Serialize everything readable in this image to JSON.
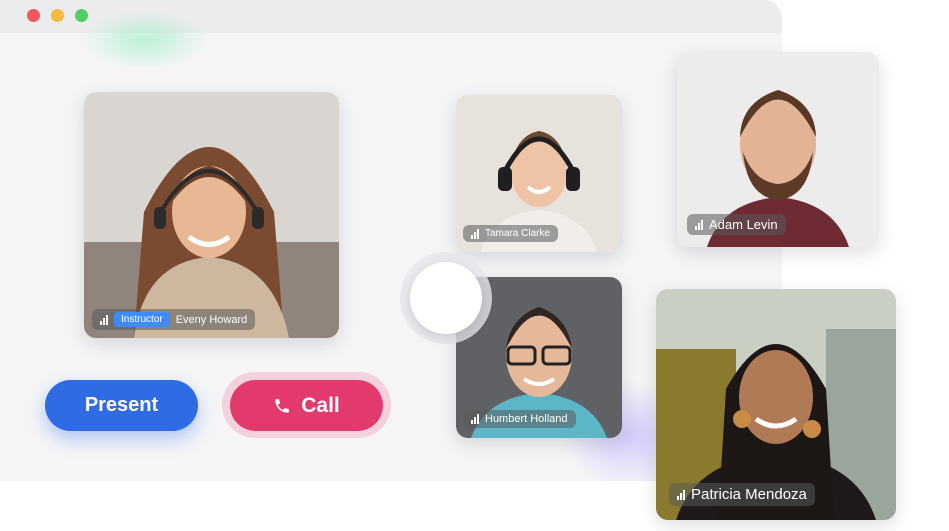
{
  "window": {
    "controls": [
      "close",
      "minimize",
      "maximize"
    ]
  },
  "participants": {
    "instructor": {
      "name": "Eveny Howard",
      "role_badge": "Instructor",
      "icon": "signal-bars-icon"
    },
    "tamara": {
      "name": "Tamara Clarke",
      "icon": "signal-bars-icon"
    },
    "adam": {
      "name": "Adam Levin",
      "icon": "signal-bars-icon"
    },
    "humbert": {
      "name": "Humbert Holland",
      "icon": "signal-bars-icon"
    },
    "patricia": {
      "name": "Patricia Mendoza",
      "icon": "signal-bars-icon"
    }
  },
  "actions": {
    "present_label": "Present",
    "call_label": "Call",
    "call_icon": "phone-icon"
  },
  "colors": {
    "present": "#2f6be4",
    "call": "#e33a6e",
    "badge": "#3d8bfd"
  }
}
